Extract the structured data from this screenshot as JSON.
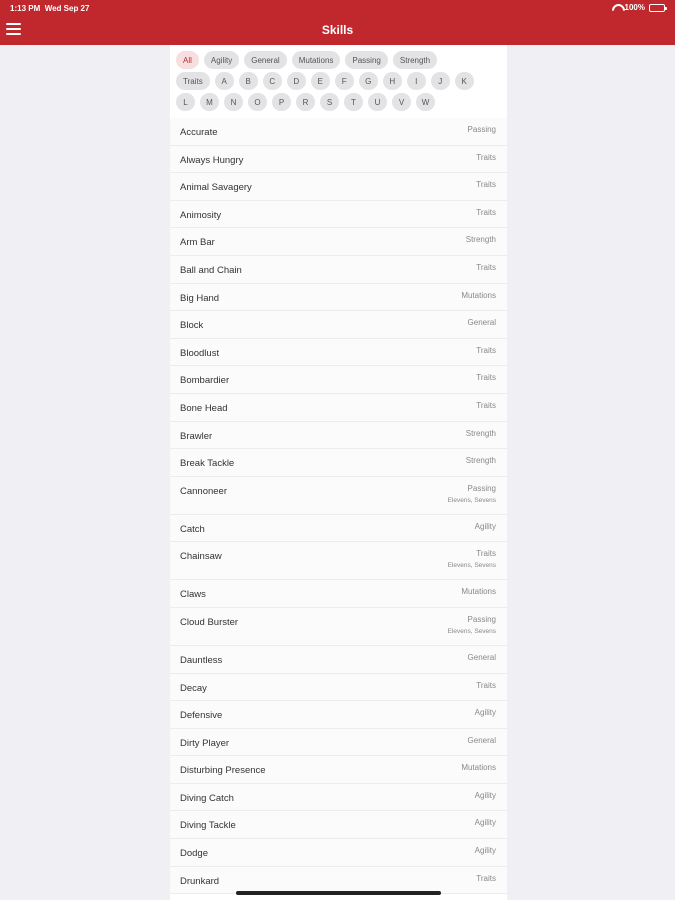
{
  "status_bar": {
    "time": "1:13 PM",
    "date": "Wed Sep 27",
    "battery": "100%"
  },
  "header": {
    "title": "Skills",
    "menu_icon": "hamburger-icon"
  },
  "filters": {
    "categories": [
      "All",
      "Agility",
      "General",
      "Mutations",
      "Passing",
      "Strength",
      "Traits"
    ],
    "letters_row1": [
      "A",
      "B",
      "C",
      "D",
      "E",
      "F",
      "G",
      "H",
      "I",
      "J",
      "K"
    ],
    "letters_row2": [
      "L",
      "M",
      "N",
      "O",
      "P",
      "R",
      "S",
      "T",
      "U",
      "V",
      "W"
    ],
    "selected": "All"
  },
  "skills": [
    {
      "name": "Accurate",
      "category": "Passing",
      "note": ""
    },
    {
      "name": "Always Hungry",
      "category": "Traits",
      "note": ""
    },
    {
      "name": "Animal Savagery",
      "category": "Traits",
      "note": ""
    },
    {
      "name": "Animosity",
      "category": "Traits",
      "note": ""
    },
    {
      "name": "Arm Bar",
      "category": "Strength",
      "note": ""
    },
    {
      "name": "Ball and Chain",
      "category": "Traits",
      "note": ""
    },
    {
      "name": "Big Hand",
      "category": "Mutations",
      "note": ""
    },
    {
      "name": "Block",
      "category": "General",
      "note": ""
    },
    {
      "name": "Bloodlust",
      "category": "Traits",
      "note": ""
    },
    {
      "name": "Bombardier",
      "category": "Traits",
      "note": ""
    },
    {
      "name": "Bone Head",
      "category": "Traits",
      "note": ""
    },
    {
      "name": "Brawler",
      "category": "Strength",
      "note": ""
    },
    {
      "name": "Break Tackle",
      "category": "Strength",
      "note": ""
    },
    {
      "name": "Cannoneer",
      "category": "Passing",
      "note": "Elevens, Sevens"
    },
    {
      "name": "Catch",
      "category": "Agility",
      "note": ""
    },
    {
      "name": "Chainsaw",
      "category": "Traits",
      "note": "Elevens, Sevens"
    },
    {
      "name": "Claws",
      "category": "Mutations",
      "note": ""
    },
    {
      "name": "Cloud Burster",
      "category": "Passing",
      "note": "Elevens, Sevens"
    },
    {
      "name": "Dauntless",
      "category": "General",
      "note": ""
    },
    {
      "name": "Decay",
      "category": "Traits",
      "note": ""
    },
    {
      "name": "Defensive",
      "category": "Agility",
      "note": ""
    },
    {
      "name": "Dirty Player",
      "category": "General",
      "note": ""
    },
    {
      "name": "Disturbing Presence",
      "category": "Mutations",
      "note": ""
    },
    {
      "name": "Diving Catch",
      "category": "Agility",
      "note": ""
    },
    {
      "name": "Diving Tackle",
      "category": "Agility",
      "note": ""
    },
    {
      "name": "Dodge",
      "category": "Agility",
      "note": ""
    },
    {
      "name": "Drunkard",
      "category": "Traits",
      "note": ""
    }
  ]
}
